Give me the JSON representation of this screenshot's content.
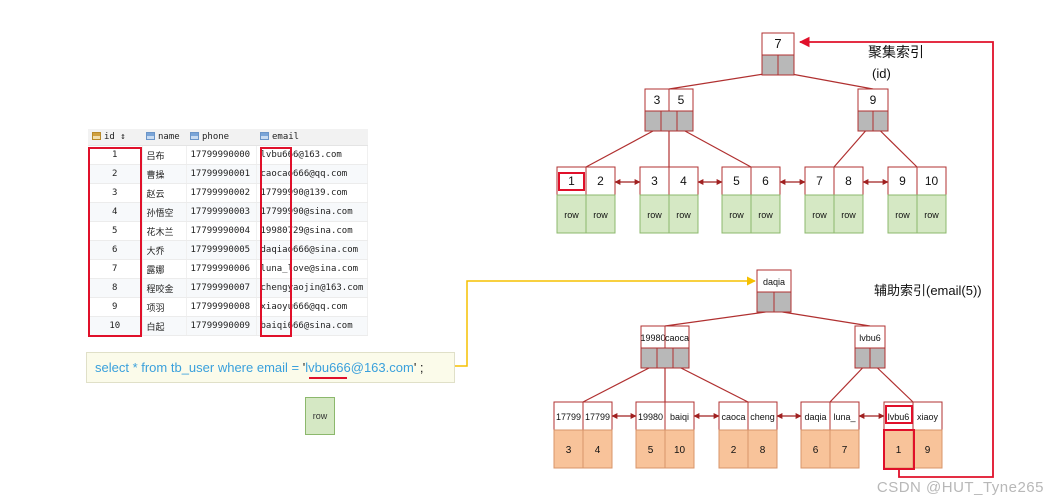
{
  "table": {
    "columns": [
      "id",
      "name",
      "phone",
      "email"
    ],
    "rows": [
      [
        "1",
        "吕布",
        "17799990000",
        "lvbu666@163.com"
      ],
      [
        "2",
        "曹操",
        "17799990001",
        "caocao666@qq.com"
      ],
      [
        "3",
        "赵云",
        "17799990002",
        "17799990@139.com"
      ],
      [
        "4",
        "孙悟空",
        "17799990003",
        "17799990@sina.com"
      ],
      [
        "5",
        "花木兰",
        "17799990004",
        "19980729@sina.com"
      ],
      [
        "6",
        "大乔",
        "17799990005",
        "daqiao666@sina.com"
      ],
      [
        "7",
        "露娜",
        "17799990006",
        "luna_love@sina.com"
      ],
      [
        "8",
        "程咬金",
        "17799990007",
        "chengyaojin@163.com"
      ],
      [
        "9",
        "项羽",
        "17799990008",
        "xiaoyu666@qq.com"
      ],
      [
        "10",
        "白起",
        "17799990009",
        "baiqi666@sina.com"
      ]
    ]
  },
  "sql": {
    "prefix": "select * from tb_user where email = ",
    "quote": "'",
    "value": "lvbu666@163.com",
    "suffix": "' ;"
  },
  "row_label": "row",
  "clustered_index": {
    "title": "聚集索引",
    "subtitle": "(id)",
    "root": [
      "7"
    ],
    "level2": [
      [
        "3",
        "5"
      ],
      [
        "9"
      ]
    ],
    "leaves": [
      [
        "1",
        "2"
      ],
      [
        "3",
        "4"
      ],
      [
        "5",
        "6"
      ],
      [
        "7",
        "8"
      ],
      [
        "9",
        "10"
      ]
    ],
    "leaf_data_label": "row"
  },
  "secondary_index": {
    "title": "辅助索引(email(5))",
    "root": [
      "daqia"
    ],
    "level2": [
      [
        "19980",
        "caoca"
      ],
      [
        "lvbu6"
      ]
    ],
    "leaves": [
      [
        "17799",
        "17799"
      ],
      [
        "19980",
        "baiqi"
      ],
      [
        "caoca",
        "cheng"
      ],
      [
        "daqia",
        "luna_"
      ],
      [
        "lvbu6",
        "xiaoy"
      ]
    ],
    "leaf_ids": [
      [
        "3",
        "4"
      ],
      [
        "5",
        "10"
      ],
      [
        "2",
        "8"
      ],
      [
        "6",
        "7"
      ],
      [
        "1",
        "9"
      ]
    ]
  },
  "colors": {
    "node_border": "#b03030",
    "pointer_fill": "#b8b8b8",
    "clustered_leaf": "#d5e8c4",
    "secondary_leaf": "#f8c39a",
    "highlight": "#e0102a",
    "connector": "#f5c000",
    "sql_text": "#3aa0dc"
  },
  "watermark": "CSDN @HUT_Tyne265"
}
